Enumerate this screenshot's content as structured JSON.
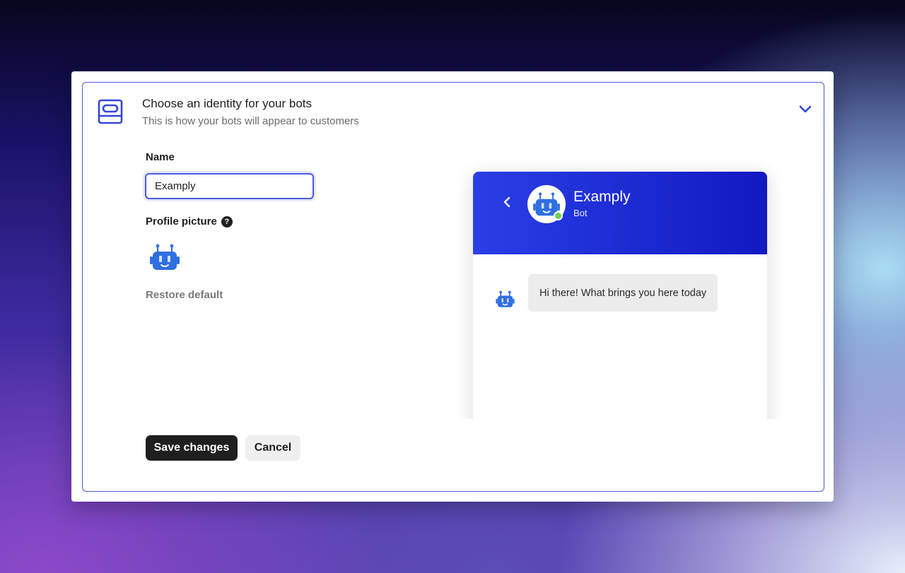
{
  "section": {
    "title": "Choose an identity for your bots",
    "subtitle": "This is how your bots will appear to customers"
  },
  "form": {
    "name_label": "Name",
    "name_value": "Examply",
    "profile_picture_label": "Profile picture",
    "help_glyph": "?",
    "restore_default": "Restore default"
  },
  "preview": {
    "bot_name": "Examply",
    "bot_role": "Bot",
    "message": "Hi there! What brings you here today"
  },
  "actions": {
    "save_label": "Save changes",
    "cancel_label": "Cancel"
  },
  "icons": {
    "header": "bot-card-icon",
    "collapse": "chevron-down-icon",
    "back": "chevron-left-icon",
    "avatar": "robot-icon",
    "help": "question-circle-icon"
  },
  "colors": {
    "accent": "#4a5be0",
    "header_gradient_start": "#2a3fe6",
    "header_gradient_end": "#1219c2",
    "online": "#6fcf4b",
    "robot_blue": "#2f6fe0"
  }
}
